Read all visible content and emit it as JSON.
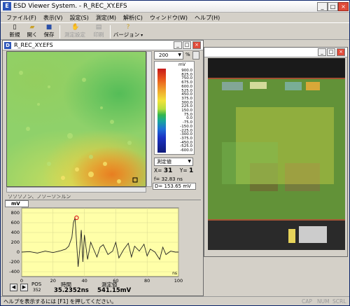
{
  "app": {
    "title": "ESD Viewer System. - R_REC_XY.EFS"
  },
  "menu": [
    "ファイル(F)",
    "表示(V)",
    "設定(S)",
    "測定(M)",
    "解析(C)",
    "ウィンドウ(W)",
    "ヘルプ(H)"
  ],
  "toolbar": {
    "new": "新規",
    "open": "開く",
    "save": "保存",
    "measure_settings": "測定設定",
    "print": "印刷",
    "version": "バージョン"
  },
  "map_window": {
    "title": "R_REC_XY.EFS",
    "zoom_value": "200",
    "zoom_unit": "%",
    "scale_unit": "mV",
    "scale_ticks": [
      "900.0",
      "825.0",
      "750.0",
      "675.0",
      "600.0",
      "525.0",
      "450.0",
      "375.0",
      "300.0",
      "225.0",
      "150.0",
      "75.0",
      "0.0",
      "-75.0",
      "-150.0",
      "-225.0",
      "-300.0",
      "-375.0",
      "-450.0",
      "-525.0",
      "-600.0"
    ],
    "value_mode": "測定値",
    "x_label": "X=",
    "x_value": "31",
    "y_label": "Y=",
    "y_value": "1",
    "f_label": "f=",
    "f_value": "32.83 ns",
    "d_label": "D=",
    "d_value": "153.65 mV",
    "truncated_label": "ソソソノン、ノソーソ＞ルン"
  },
  "waveform": {
    "unit": "mV",
    "pos_label": "POS",
    "pos_value": "352",
    "time_label": "時間",
    "time_value": "35.2352ns",
    "measure_label": "測定値",
    "measure_value": "541.15mV"
  },
  "chart_data": {
    "type": "line",
    "title": "",
    "xlabel": "ns",
    "ylabel": "mV",
    "xlim": [
      0,
      100
    ],
    "ylim": [
      -500,
      900
    ],
    "xticks": [
      0,
      20,
      40,
      60,
      80,
      100
    ],
    "yticks": [
      800,
      600,
      400,
      200,
      0,
      -200,
      -400
    ],
    "series": [
      {
        "x": [
          0,
          5,
          10,
          15,
          20,
          25,
          28,
          30,
          32,
          33,
          34,
          35,
          36,
          37,
          38,
          39,
          40,
          42,
          44,
          46,
          48,
          50,
          52,
          55,
          58,
          60,
          62,
          65,
          68,
          70,
          72,
          75,
          78,
          80,
          82,
          85,
          88,
          90,
          92,
          95,
          98,
          100
        ],
        "values": [
          0,
          10,
          -20,
          20,
          -10,
          30,
          60,
          120,
          300,
          600,
          700,
          200,
          -300,
          50,
          450,
          -200,
          350,
          -150,
          200,
          50,
          -100,
          100,
          150,
          -50,
          20,
          200,
          -120,
          50,
          180,
          -100,
          120,
          20,
          160,
          -80,
          60,
          0,
          -150,
          100,
          -50,
          20,
          0,
          0
        ],
        "marker": {
          "x": 35,
          "y": 700
        }
      }
    ]
  },
  "statusbar": {
    "help": "ヘルプを表示するには [F1] を押してください。",
    "caps": "CAP",
    "num": "NUM",
    "scrl": "SCRL"
  }
}
